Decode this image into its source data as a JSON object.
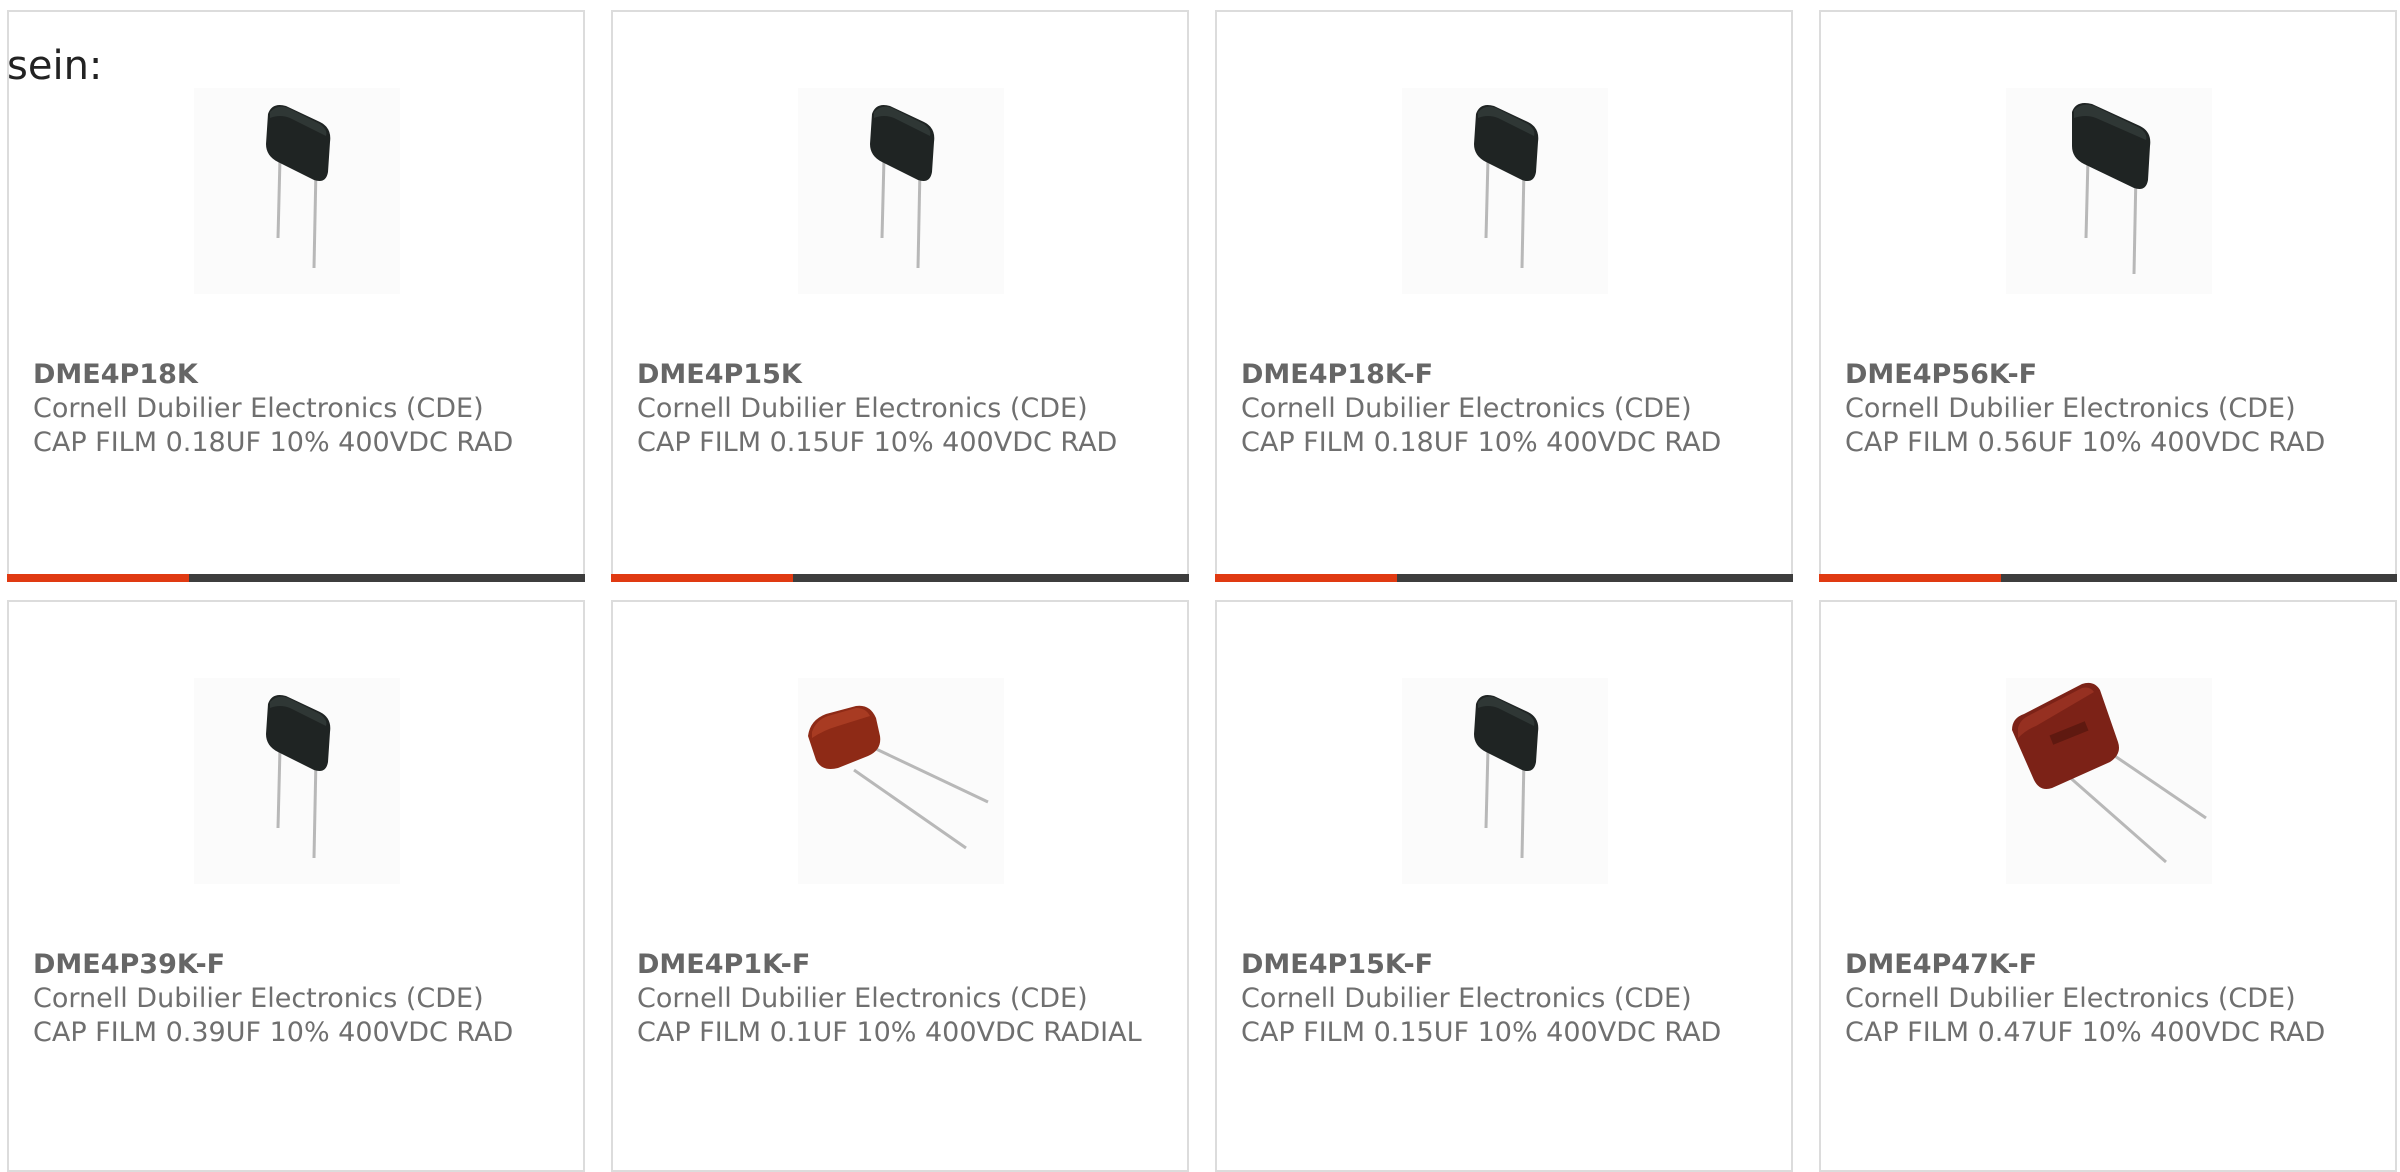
{
  "intro_text": "sein:",
  "colors": {
    "accent": "#e03a12",
    "bar": "#3d3d3d",
    "text": "#6f6f6f",
    "border": "#dcdcdc"
  },
  "products": [
    {
      "part": "DME4P18K",
      "manufacturer": "Cornell Dubilier Electronics (CDE)",
      "description": "CAP FILM 0.18UF 10% 400VDC RAD",
      "image": "black-film-capacitor-icon"
    },
    {
      "part": "DME4P15K",
      "manufacturer": "Cornell Dubilier Electronics (CDE)",
      "description": "CAP FILM 0.15UF 10% 400VDC RAD",
      "image": "black-film-capacitor-icon"
    },
    {
      "part": "DME4P18K-F",
      "manufacturer": "Cornell Dubilier Electronics (CDE)",
      "description": "CAP FILM 0.18UF 10% 400VDC RAD",
      "image": "black-film-capacitor-icon"
    },
    {
      "part": "DME4P56K-F",
      "manufacturer": "Cornell Dubilier Electronics (CDE)",
      "description": "CAP FILM 0.56UF 10% 400VDC RAD",
      "image": "black-film-capacitor-icon"
    },
    {
      "part": "DME4P39K-F",
      "manufacturer": "Cornell Dubilier Electronics (CDE)",
      "description": "CAP FILM 0.39UF 10% 400VDC RAD",
      "image": "black-film-capacitor-icon"
    },
    {
      "part": "DME4P1K-F",
      "manufacturer": "Cornell Dubilier Electronics (CDE)",
      "description": "CAP FILM 0.1UF 10% 400VDC RADIAL",
      "image": "red-film-capacitor-small-icon"
    },
    {
      "part": "DME4P15K-F",
      "manufacturer": "Cornell Dubilier Electronics (CDE)",
      "description": "CAP FILM 0.15UF 10% 400VDC RAD",
      "image": "black-film-capacitor-icon"
    },
    {
      "part": "DME4P47K-F",
      "manufacturer": "Cornell Dubilier Electronics (CDE)",
      "description": "CAP FILM 0.47UF 10% 400VDC RAD",
      "image": "red-film-capacitor-large-icon"
    }
  ]
}
